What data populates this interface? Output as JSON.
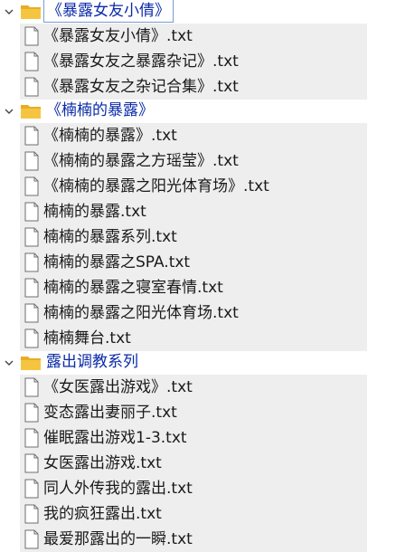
{
  "folders": [
    {
      "name": "《暴露女友小倩》",
      "selected": true,
      "icon": "folder-icon",
      "files": [
        "《暴露女友小倩》.txt",
        "《暴露女友之暴露杂记》.txt",
        "《暴露女友之杂记合集》.txt"
      ]
    },
    {
      "name": "《楠楠的暴露》",
      "selected": false,
      "icon": "folder-icon",
      "files": [
        "《楠楠的暴露》.txt",
        "《楠楠的暴露之方瑶莹》.txt",
        "《楠楠的暴露之阳光体育场》.txt",
        "楠楠的暴露.txt",
        "楠楠的暴露系列.txt",
        "楠楠的暴露之SPA.txt",
        "楠楠的暴露之寝室春情.txt",
        "楠楠的暴露之阳光体育场.txt",
        "楠楠舞台.txt"
      ]
    },
    {
      "name": "露出调教系列",
      "selected": false,
      "icon": "folder-icon",
      "files": [
        "《女医露出游戏》.txt",
        "变态露出妻丽子.txt",
        "催眠露出游戏1-3.txt",
        "女医露出游戏.txt",
        "同人外传我的露出.txt",
        "我的疯狂露出.txt",
        "最爱那露出的一瞬.txt"
      ]
    }
  ],
  "colors": {
    "folder_label": "#0a2aa8",
    "folder_fill": "#f5c542",
    "group_background": "#eeeeee",
    "selection_border": "#7a9bd6"
  }
}
